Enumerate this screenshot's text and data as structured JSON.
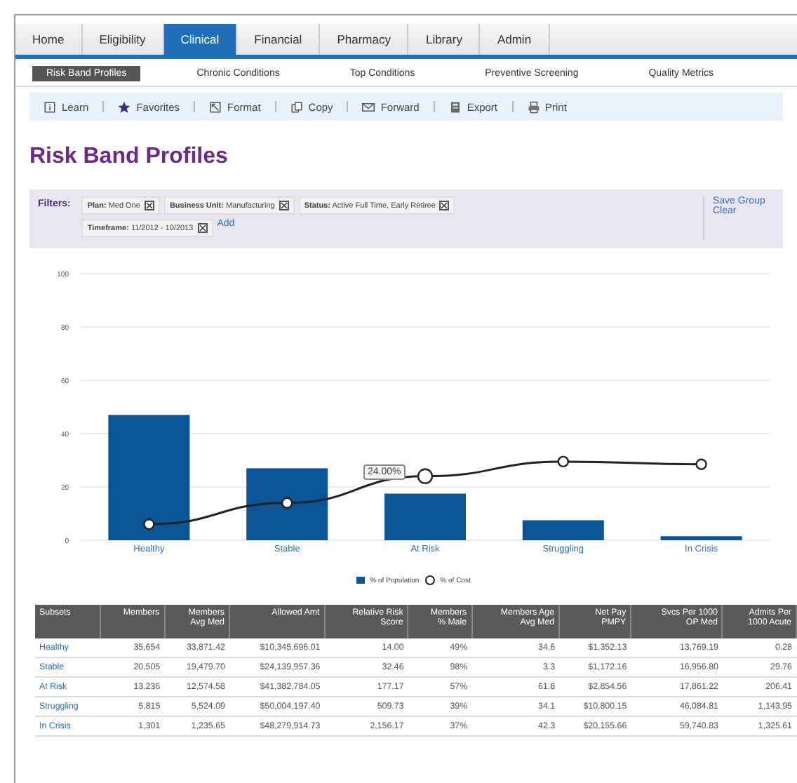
{
  "tabs": [
    {
      "label": "Home",
      "selected": false
    },
    {
      "label": "Eligibility",
      "selected": false
    },
    {
      "label": "Clinical",
      "selected": true
    },
    {
      "label": "Financial",
      "selected": false
    },
    {
      "label": "Pharmacy",
      "selected": false
    },
    {
      "label": "Library",
      "selected": false
    },
    {
      "label": "Admin",
      "selected": false
    }
  ],
  "subtabs": [
    {
      "label": "Risk Band Profiles",
      "selected": true
    },
    {
      "label": "Chronic Conditions",
      "selected": false
    },
    {
      "label": "Top Conditions",
      "selected": false
    },
    {
      "label": "Preventive Screening",
      "selected": false
    },
    {
      "label": "Quality Metrics",
      "selected": false
    }
  ],
  "toolbar": [
    {
      "kind": "info",
      "label": "Learn"
    },
    {
      "kind": "star",
      "label": "Favorites"
    },
    {
      "kind": "format",
      "label": "Format"
    },
    {
      "kind": "copy",
      "label": "Copy"
    },
    {
      "kind": "mail",
      "label": "Forward"
    },
    {
      "kind": "export",
      "label": "Export"
    },
    {
      "kind": "print",
      "label": "Print"
    }
  ],
  "title": "Risk Band Profiles",
  "filters": {
    "label": "Filters:",
    "chips": [
      {
        "name": "Plan:",
        "value": "Med One"
      },
      {
        "name": "Business Unit:",
        "value": "Manufacturing"
      },
      {
        "name": "Status:",
        "value": "Active Full Time, Early Retiree"
      },
      {
        "name": "Timeframe:",
        "value": "11/2012 - 10/2013"
      }
    ],
    "add": "Add",
    "actions": [
      "Save Group",
      "Clear"
    ]
  },
  "chart": {
    "tooltip": "24.00%",
    "chart_data": {
      "type": "bar",
      "grid": true,
      "legend": "bottom",
      "categories": [
        "Healthy",
        "Stable",
        "At Risk",
        "Struggling",
        "In Crisis"
      ],
      "ylim": [
        0,
        100
      ],
      "yticks": [
        0,
        20,
        40,
        60,
        80,
        100
      ],
      "series": [
        {
          "name": "% of Population",
          "color": "#0b5597",
          "values": [
            47,
            27,
            17.5,
            7.5,
            1.5
          ]
        },
        {
          "name": "% of Cost",
          "type": "line",
          "marker": "circle",
          "color": "#222222",
          "values": [
            6,
            14,
            24,
            29.5,
            28.5
          ]
        }
      ]
    }
  },
  "table": {
    "columns": [
      "Subsets",
      "Members",
      "Members\nAvg Med",
      "Allowed Amt",
      "Relative Risk\nScore",
      "Members\n% Male",
      "Members Age\nAvg Med",
      "Net Pay\nPMPY",
      "Svcs Per 1000\nOP Med",
      "Admits Per\n1000 Acute"
    ],
    "rows": [
      [
        "Healthy",
        "35,654",
        "33,871.42",
        "$10,345,696.01",
        "14.00",
        "49%",
        "34.6",
        "$1,352.13",
        "13,769.19",
        "0.28"
      ],
      [
        "Stable",
        "20,505",
        "19,479.70",
        "$24,139,957.36",
        "32.46",
        "98%",
        "3.3",
        "$1,172.16",
        "16,956.80",
        "29.76"
      ],
      [
        "At Risk",
        "13,236",
        "12,574.58",
        "$41,382,784.05",
        "177.17",
        "57%",
        "61.8",
        "$2,854.56",
        "17,861.22",
        "206.41"
      ],
      [
        "Struggling",
        "5,815",
        "5,524.09",
        "$50,004,197.40",
        "509.73",
        "39%",
        "34.1",
        "$10,800.15",
        "46,084.81",
        "1,143.95"
      ],
      [
        "In Crisis",
        "1,301",
        "1,235.65",
        "$48,279,914.73",
        "2,156.17",
        "37%",
        "42.3",
        "$20,155.66",
        "59,740.83",
        "1,325.61"
      ]
    ]
  }
}
